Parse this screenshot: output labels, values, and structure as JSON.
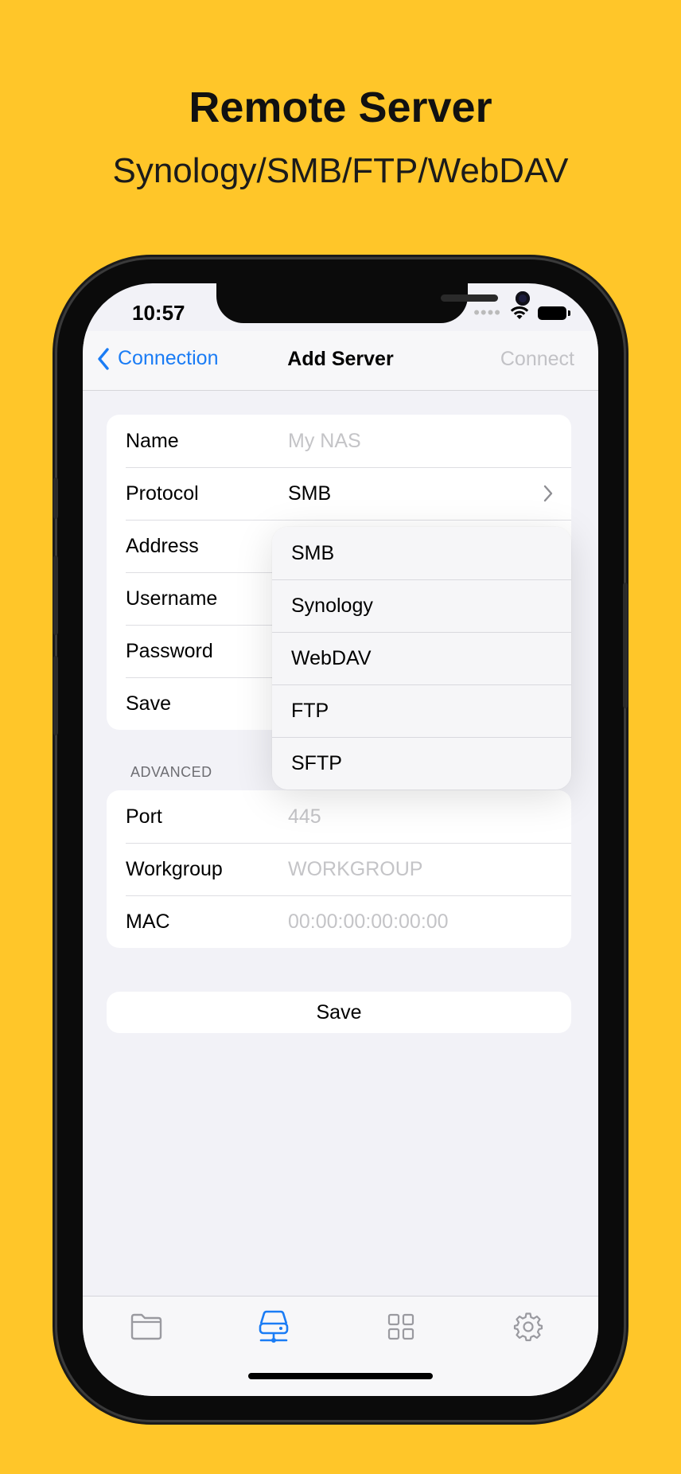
{
  "promo": {
    "title": "Remote Server",
    "subtitle": "Synology/SMB/FTP/WebDAV"
  },
  "status_bar": {
    "time": "10:57"
  },
  "nav": {
    "back_label": "Connection",
    "title": "Add Server",
    "connect_label": "Connect"
  },
  "form": {
    "name": {
      "label": "Name",
      "placeholder": "My NAS"
    },
    "protocol": {
      "label": "Protocol",
      "value": "SMB"
    },
    "address": {
      "label": "Address"
    },
    "username": {
      "label": "Username"
    },
    "password": {
      "label": "Password"
    },
    "save_toggle": {
      "label": "Save"
    }
  },
  "advanced": {
    "header": "ADVANCED",
    "port": {
      "label": "Port",
      "placeholder": "445"
    },
    "workgroup": {
      "label": "Workgroup",
      "placeholder": "WORKGROUP"
    },
    "mac": {
      "label": "MAC",
      "placeholder": "00:00:00:00:00:00"
    }
  },
  "save_button": "Save",
  "protocol_menu": [
    "SMB",
    "Synology",
    "WebDAV",
    "FTP",
    "SFTP"
  ],
  "tabbar": {
    "items": [
      {
        "icon": "folder-icon"
      },
      {
        "icon": "server-icon",
        "active": true
      },
      {
        "icon": "grid-icon"
      },
      {
        "icon": "gear-icon"
      }
    ],
    "active_color": "#1A7CF5",
    "inactive_color": "#9A9AA0"
  },
  "colors": {
    "background": "#FFC629",
    "accent": "#1A7CF5"
  }
}
